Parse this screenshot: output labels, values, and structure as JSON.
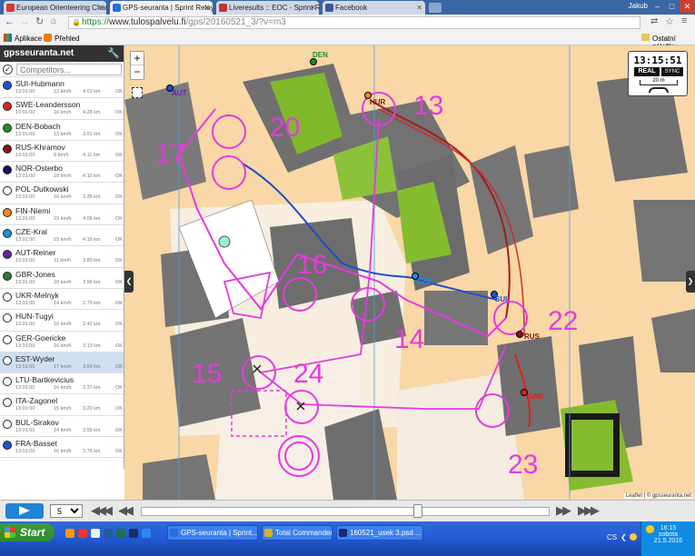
{
  "browser": {
    "tabs": [
      {
        "title": "European Orienteering Cham",
        "color": "#d33"
      },
      {
        "title": "GPS-seuranta | Sprint Relay",
        "color": "#2a6fd6"
      },
      {
        "title": "Liveresults :: EOC - Sprint R",
        "color": "#c8302e"
      },
      {
        "title": "Facebook",
        "color": "#3b5998"
      }
    ],
    "user": "Jakub",
    "url_scheme": "https://",
    "url_host": "www.tulospalvelu.fi",
    "url_path": "/gps/20160521_3/?v=m3",
    "bookmarks": [
      {
        "label": "Aplikace"
      },
      {
        "label": "Přehled"
      }
    ],
    "other_bookmarks": "Ostatní záložky"
  },
  "sidebar": {
    "brand": "gpsseuranta.net",
    "search_placeholder": "Competitors...",
    "competitors": [
      {
        "name": "SUI-Hubmann",
        "time": "13:01:00",
        "speed": "12 km/h",
        "dist": "4.01 km",
        "status": "OK",
        "color": "#1f4fd1",
        "selected": false
      },
      {
        "name": "SWE-Leandersson",
        "time": "13:01:00",
        "speed": "16 km/h",
        "dist": "4.28 km",
        "status": "OK",
        "color": "#e02020",
        "selected": false
      },
      {
        "name": "DEN-Bobach",
        "time": "13:01:00",
        "speed": "13 km/h",
        "dist": "3.91 km",
        "status": "OK",
        "color": "#1f8f1f",
        "selected": false
      },
      {
        "name": "RUS-Khramov",
        "time": "13:01:00",
        "speed": "8 km/h",
        "dist": "4.11 km",
        "status": "OK",
        "color": "#8b1212",
        "selected": false
      },
      {
        "name": "NOR-Osterbo",
        "time": "13:01:00",
        "speed": "18 km/h",
        "dist": "4.10 km",
        "status": "OK",
        "color": "#101060",
        "selected": false
      },
      {
        "name": "POL-Dutkowski",
        "time": "13:01:00",
        "speed": "16 km/h",
        "dist": "3.35 km",
        "status": "OK",
        "color": "#ffffff",
        "selected": false
      },
      {
        "name": "FIN-Niemi",
        "time": "13:01:00",
        "speed": "19 km/h",
        "dist": "4.06 km",
        "status": "OK",
        "color": "#f08a1c",
        "selected": false
      },
      {
        "name": "CZE-Kral",
        "time": "13:01:00",
        "speed": "15 km/h",
        "dist": "4.15 km",
        "status": "OK",
        "color": "#1c8fe0",
        "selected": false
      },
      {
        "name": "AUT-Reiner",
        "time": "13:01:00",
        "speed": "11 km/h",
        "dist": "3.80 km",
        "status": "OK",
        "color": "#6a1fa8",
        "selected": false
      },
      {
        "name": "GBR-Jones",
        "time": "13:01:00",
        "speed": "18 km/h",
        "dist": "3.96 km",
        "status": "OK",
        "color": "#2c7a2c",
        "selected": false
      },
      {
        "name": "UKR-Melnyk",
        "time": "13:01:00",
        "speed": "14 km/h",
        "dist": "2.70 km",
        "status": "OK",
        "color": "#ffffff",
        "selected": false
      },
      {
        "name": "HUN-Tugyi",
        "time": "13:01:00",
        "speed": "16 km/h",
        "dist": "2.42 km",
        "status": "OK",
        "color": "#ffffff",
        "selected": false
      },
      {
        "name": "GER-Goericke",
        "time": "13:01:00",
        "speed": "16 km/h",
        "dist": "3.13 km",
        "status": "OK",
        "color": "#ffffff",
        "selected": false
      },
      {
        "name": "EST-Wyder",
        "time": "13:01:00",
        "speed": "17 km/h",
        "dist": "3.56 km",
        "status": "OK",
        "color": "#ffffff",
        "selected": true
      },
      {
        "name": "LTU-Bartkevicius",
        "time": "13:01:00",
        "speed": "16 km/h",
        "dist": "3.37 km",
        "status": "OK",
        "color": "#ffffff",
        "selected": false
      },
      {
        "name": "ITA-Zagonel",
        "time": "13:01:00",
        "speed": "15 km/h",
        "dist": "3.20 km",
        "status": "OK",
        "color": "#ffffff",
        "selected": false
      },
      {
        "name": "BUL-Sirakov",
        "time": "13:01:00",
        "speed": "14 km/h",
        "dist": "3.55 km",
        "status": "OK",
        "color": "#ffffff",
        "selected": false
      },
      {
        "name": "FRA-Basset",
        "time": "13:01:00",
        "speed": "10 km/h",
        "dist": "3.76 km",
        "status": "OK",
        "color": "#1f55c8",
        "selected": false
      }
    ]
  },
  "map": {
    "clock": "13:15:51",
    "mode": "REAL",
    "sync": "SYNC",
    "scale": "20 m",
    "attribution": "Leaflet | © gpsseuranta.net",
    "control_numbers": [
      "13",
      "20",
      "17",
      "16",
      "14",
      "22",
      "15",
      "24",
      "23"
    ],
    "runner_labels": [
      "DEN",
      "AUT",
      "HUR",
      "CZE",
      "SUI",
      "RUS",
      "SWE",
      "FRA"
    ]
  },
  "controls": {
    "speed_value": "5"
  },
  "taskbar": {
    "start": "Start",
    "tasks": [
      {
        "label": "GPS-seuranta | Sprint...",
        "color": "#2a6fd6"
      },
      {
        "label": "Total Commander 7.5...",
        "color": "#d8b21c"
      },
      {
        "label": "160521_usek 3.psd ...",
        "color": "#1a2a6c"
      }
    ],
    "lang": "CS",
    "time": "16:15",
    "day": "sobota",
    "date": "21.5.2016"
  }
}
